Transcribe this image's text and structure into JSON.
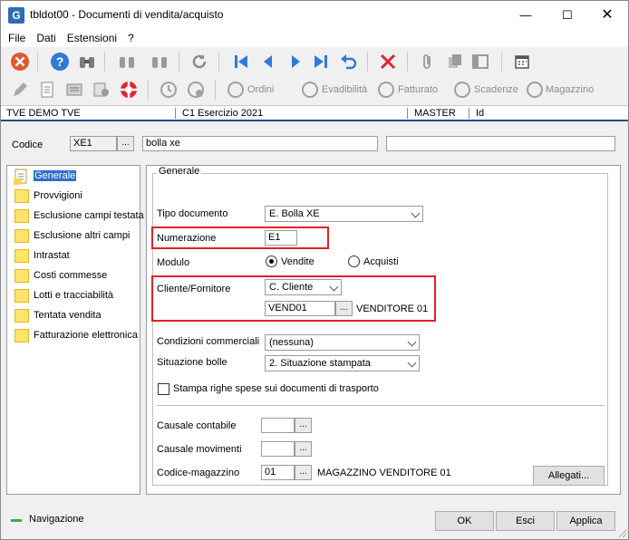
{
  "window": {
    "title": "tbldot00 - Documenti di vendita/acquisto",
    "app_icon_letter": "G"
  },
  "menu": [
    "File",
    "Dati",
    "Estensioni",
    "?"
  ],
  "toolbar2": {
    "ordini": "Ordini",
    "evadibilita": "Evadibilità",
    "fatturato": "Fatturato",
    "scadenze": "Scadenze",
    "magazzino": "Magazzino"
  },
  "infobar": {
    "company": "TVE DEMO TVE",
    "year": "C1 Esercizio 2021",
    "user": "MASTER",
    "id": "Id"
  },
  "header": {
    "codice_label": "Codice",
    "codice_value": "XE1",
    "descr_value": "bolla xe",
    "extra_value": "",
    "ellipsis": "..."
  },
  "tree": [
    {
      "label": "Generale",
      "selected": true
    },
    {
      "label": "Provvigioni"
    },
    {
      "label": "Esclusione campi testata"
    },
    {
      "label": "Esclusione altri campi"
    },
    {
      "label": "Intrastat"
    },
    {
      "label": "Costi commesse"
    },
    {
      "label": "Lotti e tracciabilità"
    },
    {
      "label": "Tentata vendita"
    },
    {
      "label": "Fatturazione elettronica"
    }
  ],
  "form": {
    "group_title": "Generale",
    "tipo_documento_label": "Tipo documento",
    "tipo_documento_value": "E. Bolla XE",
    "numerazione_label": "Numerazione",
    "numerazione_value": "E1",
    "modulo_label": "Modulo",
    "modulo_vendite": "Vendite",
    "modulo_acquisti": "Acquisti",
    "cliente_label": "Cliente/Fornitore",
    "cliente_value": "C. Cliente",
    "cliente_code": "VEND01",
    "cliente_name": "VENDITORE 01",
    "condizioni_label": "Condizioni commerciali",
    "condizioni_value": "(nessuna)",
    "situazione_label": "Situazione bolle",
    "situazione_value": "2. Situazione stampata",
    "stampa_label": "Stampa righe spese sui documenti di trasporto",
    "causale_contabile_label": "Causale contabile",
    "causale_movimenti_label": "Causale movimenti",
    "magazzino_label": "Codice-magazzino",
    "magazzino_code": "01",
    "magazzino_name": "MAGAZZINO VENDITORE 01",
    "allegati": "Allegati..."
  },
  "footer": {
    "navigazione": "Navigazione",
    "ok": "OK",
    "esci": "Esci",
    "applica": "Applica"
  },
  "colors": {
    "accent": "#1f4e8c",
    "highlight": "#e32028",
    "selection": "#2f6fd0"
  }
}
